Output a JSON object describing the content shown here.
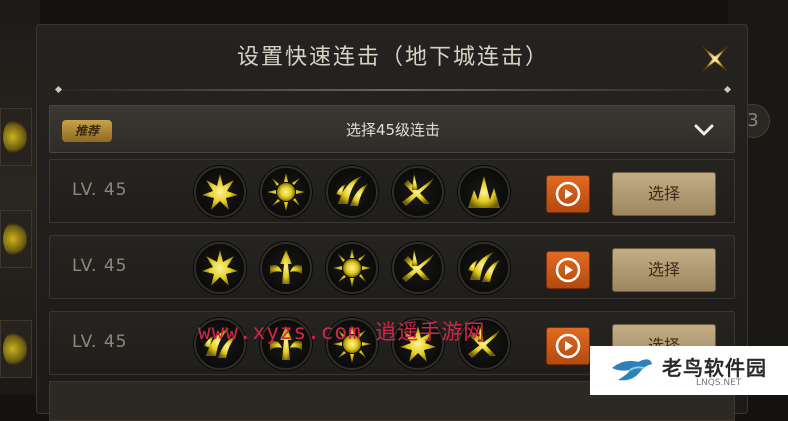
{
  "dialog": {
    "title": "设置快速连击（地下城连击）",
    "selector": {
      "badge": "推荐",
      "label": "选择45级连击"
    }
  },
  "combos": [
    {
      "level": "LV. 45",
      "skills": [
        "burst-skill-icon",
        "sun-skill-icon",
        "claw-skill-icon",
        "slash-skill-icon",
        "spike-skill-icon"
      ],
      "action_label": "选择"
    },
    {
      "level": "LV. 45",
      "skills": [
        "burst-skill-icon",
        "rise-skill-icon",
        "sun-skill-icon",
        "slash-skill-icon",
        "claw-skill-icon"
      ],
      "action_label": "选择"
    },
    {
      "level": "LV. 45",
      "skills": [
        "claw-skill-icon",
        "rise-skill-icon",
        "sun-skill-icon",
        "burst-skill-icon",
        "slash-skill-icon"
      ],
      "action_label": "选择"
    }
  ],
  "background": {
    "right_circle": "3"
  },
  "watermarks": {
    "site_text": "www.xyzs.com 逍遥手游网",
    "logo_name": "老鸟软件园",
    "logo_sub": "LNQS.NET"
  },
  "colors": {
    "accent_orange": "#d75d1a",
    "button_gold": "#b39a70",
    "skill_glow": "#e8d21e",
    "watermark_red": "#d0264a"
  }
}
